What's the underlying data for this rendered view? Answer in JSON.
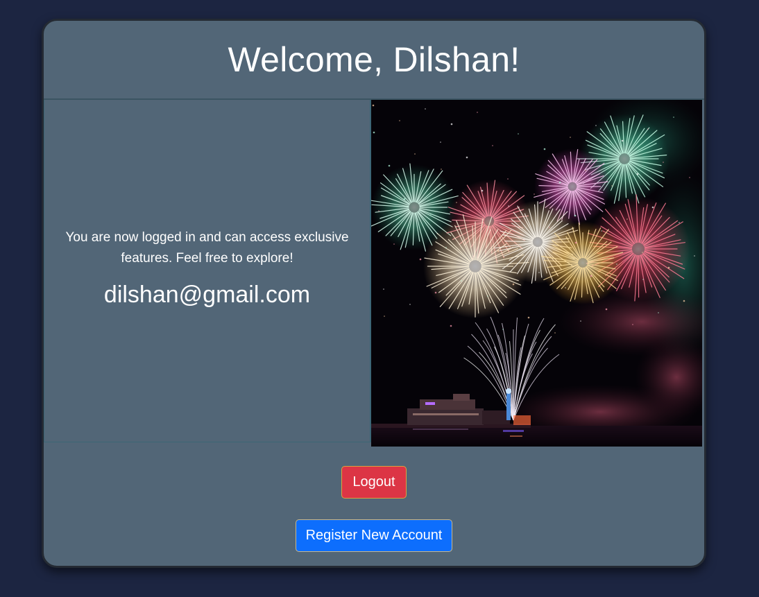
{
  "header": {
    "title": "Welcome, Dilshan!"
  },
  "info": {
    "message": "You are now logged in and can access exclusive features. Feel free to explore!",
    "email": "dilshan@gmail.com"
  },
  "image": {
    "subject": "fireworks-over-pier-at-night"
  },
  "actions": {
    "logout_label": "Logout",
    "register_label": "Register New Account"
  },
  "colors": {
    "page_background": "#1c2541",
    "card_background": "#526677",
    "logout_button": "#dc3545",
    "register_button": "#0d6efd"
  }
}
